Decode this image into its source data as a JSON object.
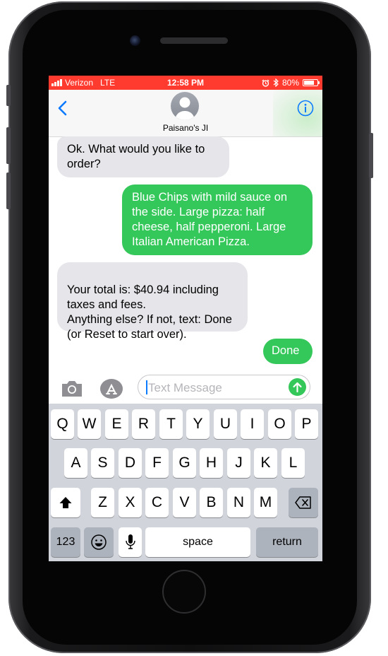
{
  "status_bar": {
    "carrier": "Verizon",
    "network": "LTE",
    "time": "12:58 PM",
    "battery": "80%",
    "battery_level": 0.8,
    "icons": [
      "signal-icon",
      "alarm-icon",
      "bluetooth-icon",
      "battery-icon"
    ]
  },
  "conversation": {
    "contact_name": "Paisano's JI",
    "messages": [
      {
        "direction": "incoming",
        "text": "Ok. What would you like to order?"
      },
      {
        "direction": "outgoing",
        "text": "Blue Chips with mild sauce on the side. Large pizza: half cheese, half pepperoni. Large Italian American Pizza."
      },
      {
        "direction": "incoming",
        "text": "Your total is: $40.94 including taxes and fees.\nAnything else? If not, text: Done (or Reset to start over)."
      },
      {
        "direction": "outgoing",
        "text": "Done"
      }
    ]
  },
  "composer": {
    "placeholder": "Text Message",
    "value": ""
  },
  "keyboard": {
    "row1": [
      "Q",
      "W",
      "E",
      "R",
      "T",
      "Y",
      "U",
      "I",
      "O",
      "P"
    ],
    "row2": [
      "A",
      "S",
      "D",
      "F",
      "G",
      "H",
      "J",
      "K",
      "L"
    ],
    "row3": [
      "Z",
      "X",
      "C",
      "V",
      "B",
      "N",
      "M"
    ],
    "numbers_label": "123",
    "space_label": "space",
    "return_label": "return"
  },
  "colors": {
    "status_bar_bg": "#ff3b30",
    "outgoing_bubble": "#34c759",
    "incoming_bubble": "#e5e5ea",
    "ios_blue": "#0a7aff"
  }
}
